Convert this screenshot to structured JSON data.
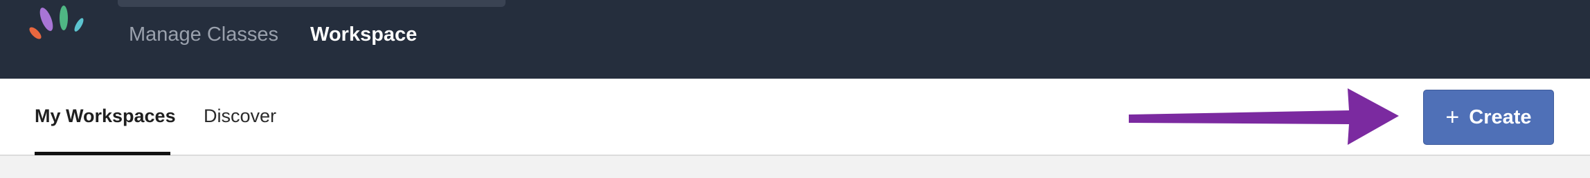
{
  "topnav": {
    "links": [
      {
        "label": "Manage Classes"
      },
      {
        "label": "Workspace"
      }
    ],
    "active": "Workspace"
  },
  "subnav": {
    "tabs": [
      {
        "label": "My Workspaces"
      },
      {
        "label": "Discover"
      }
    ],
    "active_tab": "My Workspaces"
  },
  "actions": {
    "create_label": "Create",
    "create_icon": "plus-icon"
  },
  "annotation": {
    "arrow_color": "#7b2aa0"
  },
  "colors": {
    "topbar_bg": "#252e3d",
    "button_bg": "#4f70b7",
    "logo_petals": [
      "#e8673f",
      "#a875d6",
      "#4fb784",
      "#5cc3cf"
    ]
  }
}
